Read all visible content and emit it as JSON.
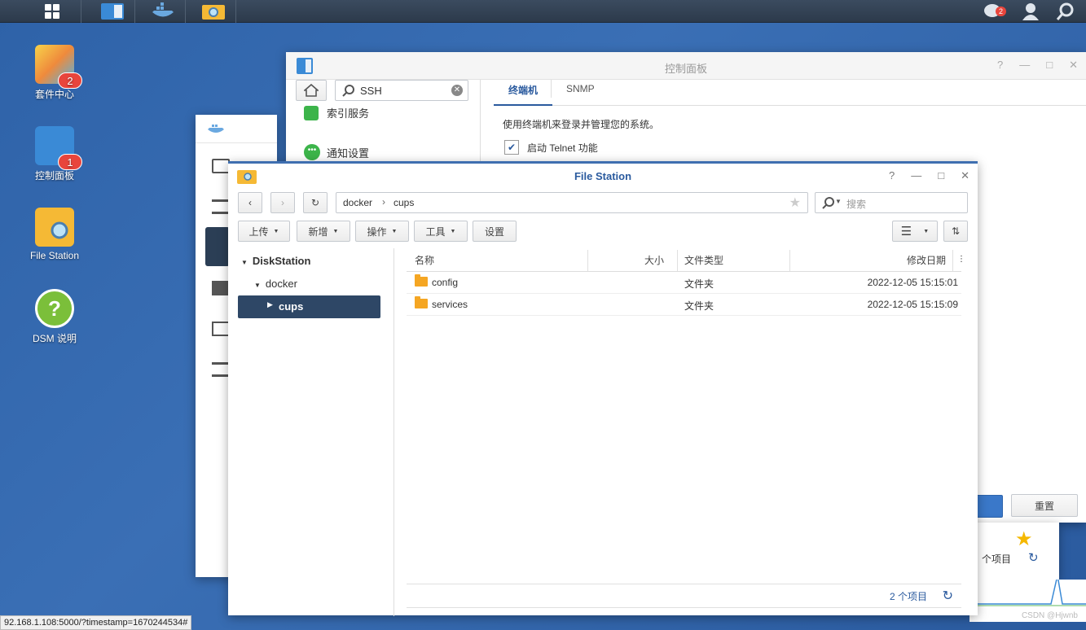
{
  "taskbar": {
    "apps": [
      "main-menu",
      "control-panel",
      "docker",
      "file-station"
    ],
    "notification_count": "2"
  },
  "desktop": [
    {
      "label": "套件中心",
      "badge": "2"
    },
    {
      "label": "控制面板",
      "badge": "1"
    },
    {
      "label": "File Station",
      "badge": ""
    },
    {
      "label": "DSM 说明",
      "badge": ""
    }
  ],
  "control_panel": {
    "title": "控制面板",
    "search_value": "SSH",
    "side_items": [
      "索引服务",
      "通知设置"
    ],
    "tabs": [
      "终端机",
      "SNMP"
    ],
    "description": "使用终端机来登录并管理您的系统。",
    "checkbox_label": "启动 Telnet 功能",
    "reset_button": "重置",
    "behind_items_label": "个项目"
  },
  "file_station": {
    "title": "File Station",
    "path": [
      "docker",
      "cups"
    ],
    "search_placeholder": "搜索",
    "toolbar": {
      "upload": "上传",
      "new": "新增",
      "action": "操作",
      "tools": "工具",
      "settings": "设置"
    },
    "tree": {
      "root": "DiskStation",
      "folder": "docker",
      "selected": "cups"
    },
    "columns": {
      "name": "名称",
      "size": "大小",
      "type": "文件类型",
      "modified": "修改日期"
    },
    "rows": [
      {
        "name": "config",
        "size": "",
        "type": "文件夹",
        "modified": "2022-12-05 15:15:01"
      },
      {
        "name": "services",
        "size": "",
        "type": "文件夹",
        "modified": "2022-12-05 15:15:09"
      }
    ],
    "item_count": "2 个项目"
  },
  "url": "92.168.1.108:5000/?timestamp=1670244534#",
  "watermark": "CSDN @Hjwnb"
}
